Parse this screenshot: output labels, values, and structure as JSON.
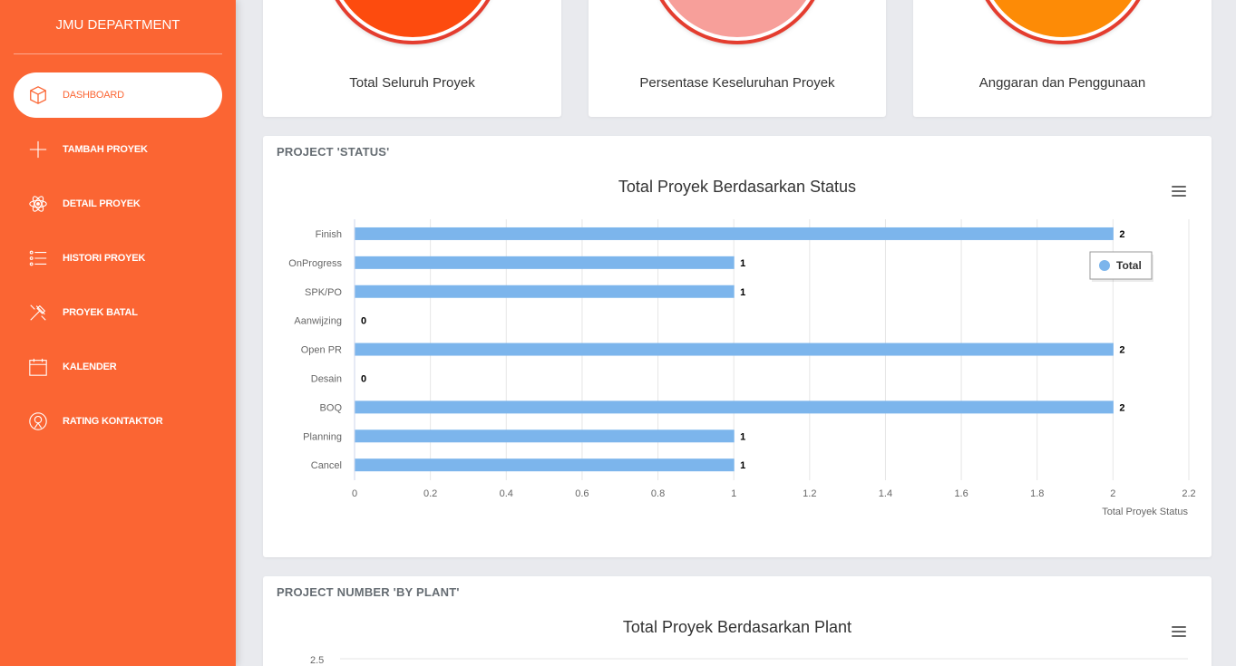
{
  "sidebar": {
    "brand": "JMU DEPARTMENT",
    "items": [
      {
        "label": "DASHBOARD",
        "icon": "box-icon",
        "active": true
      },
      {
        "label": "TAMBAH PROYEK",
        "icon": "plus-icon"
      },
      {
        "label": "DETAIL PROYEK",
        "icon": "atom-icon"
      },
      {
        "label": "HISTORI PROYEK",
        "icon": "list-icon"
      },
      {
        "label": "PROYEK BATAL",
        "icon": "tools-icon"
      },
      {
        "label": "KALENDER",
        "icon": "calendar-icon"
      },
      {
        "label": "RATING KONTAKTOR",
        "icon": "pin-icon"
      }
    ]
  },
  "top_cards": [
    {
      "caption": "Total Seluruh Proyek",
      "color": "#fd4b0e"
    },
    {
      "caption": "Persentase Keseluruhan Proyek",
      "color": "#f79f9a"
    },
    {
      "caption": "Anggaran dan Penggunaan",
      "color": "#fd8b06"
    }
  ],
  "status_section": {
    "title": "PROJECT 'STATUS'"
  },
  "plant_section": {
    "title": "PROJECT NUMBER 'BY PLANT'"
  },
  "chart_data": [
    {
      "type": "bar",
      "orientation": "horizontal",
      "title": "Total Proyek Berdasarkan Status",
      "xlabel": "Total Proyek Status",
      "ylabel": "",
      "categories": [
        "Finish",
        "OnProgress",
        "SPK/PO",
        "Aanwijzing",
        "Open PR",
        "Desain",
        "BOQ",
        "Planning",
        "Cancel"
      ],
      "series": [
        {
          "name": "Total",
          "values": [
            2,
            1,
            1,
            0,
            2,
            0,
            2,
            1,
            1
          ],
          "color": "#7cb5ec"
        }
      ],
      "xlim": [
        0,
        2.2
      ],
      "ticks": [
        "0",
        "0.2",
        "0.4",
        "0.6",
        "0.8",
        "1",
        "1.2",
        "1.4",
        "1.6",
        "1.8",
        "2",
        "2.2"
      ],
      "grid": true,
      "legend": "right"
    },
    {
      "type": "bar",
      "title": "Total Proyek Berdasarkan Plant",
      "ylim_top": "2.5"
    }
  ]
}
